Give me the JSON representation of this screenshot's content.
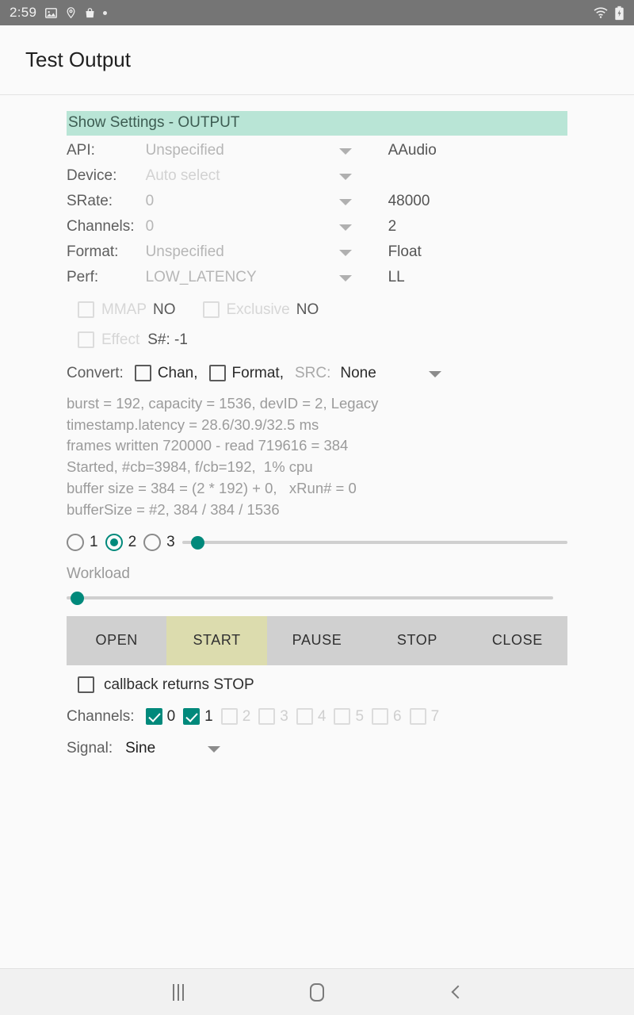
{
  "statusbar": {
    "time": "2:59",
    "icons": [
      "image-icon",
      "location-pin-icon",
      "shopping-bag-icon",
      "dot-icon"
    ],
    "right_icons": [
      "wifi-icon",
      "battery-charging-icon"
    ]
  },
  "appbar": {
    "title": "Test Output"
  },
  "settings_header": "Show Settings - OUTPUT",
  "settings_rows": [
    {
      "label": "API:",
      "requested": "Unspecified",
      "actual": "AAudio",
      "faint": false
    },
    {
      "label": "Device:",
      "requested": "Auto select",
      "actual": "",
      "faint": true
    },
    {
      "label": "SRate:",
      "requested": "0",
      "actual": "48000",
      "faint": false
    },
    {
      "label": "Channels:",
      "requested": "0",
      "actual": "2",
      "faint": false
    },
    {
      "label": "Format:",
      "requested": "Unspecified",
      "actual": "Float",
      "faint": false
    },
    {
      "label": "Perf:",
      "requested": "LOW_LATENCY",
      "actual": "LL",
      "faint": false
    }
  ],
  "mmap_row": {
    "mmap_label": "MMAP",
    "mmap_value": "NO",
    "mmap_checked": false,
    "exclusive_label": "Exclusive",
    "exclusive_value": "NO",
    "exclusive_checked": false
  },
  "effect_row": {
    "label": "Effect",
    "value": "S#: -1",
    "checked": false
  },
  "convert_row": {
    "title": "Convert:",
    "chan_label": "Chan,",
    "chan_checked": false,
    "format_label": "Format,",
    "format_checked": false,
    "src_label": "SRC:",
    "src_value": "None"
  },
  "status_lines": [
    "burst = 192, capacity = 1536, devID = 2, Legacy",
    "timestamp.latency = 28.6/30.9/32.5 ms",
    "frames written 720000 - read 719616 = 384",
    "Started, #cb=3984, f/cb=192,  1% cpu",
    "buffer size = 384 = (2 * 192) + 0,   xRun# = 0",
    "bufferSize = #2, 384 / 384 / 1536"
  ],
  "buffer_radio": {
    "options": [
      "1",
      "2",
      "3"
    ],
    "selected": "2"
  },
  "buffer_slider": {
    "percent": 4
  },
  "workload": {
    "label": "Workload",
    "percent": 1
  },
  "buttons": [
    {
      "label": "OPEN",
      "active": false
    },
    {
      "label": "START",
      "active": true
    },
    {
      "label": "PAUSE",
      "active": false
    },
    {
      "label": "STOP",
      "active": false
    },
    {
      "label": "CLOSE",
      "active": false
    }
  ],
  "callback_stop": {
    "label": "callback returns STOP",
    "checked": false
  },
  "channels_row": {
    "label": "Channels:",
    "boxes": [
      {
        "num": "0",
        "checked": true
      },
      {
        "num": "1",
        "checked": true
      },
      {
        "num": "2",
        "checked": false
      },
      {
        "num": "3",
        "checked": false
      },
      {
        "num": "4",
        "checked": false
      },
      {
        "num": "5",
        "checked": false
      },
      {
        "num": "6",
        "checked": false
      },
      {
        "num": "7",
        "checked": false
      }
    ]
  },
  "signal_row": {
    "label": "Signal:",
    "value": "Sine"
  },
  "navbar": {
    "recents": "recents-icon",
    "home": "home-icon",
    "back": "back-icon"
  },
  "colors": {
    "accent_teal": "#00897b",
    "header_mint": "#b9e5d6",
    "active_button": "#dcdcae",
    "button_bar": "#d0d0d0",
    "statusbar": "#757575"
  }
}
